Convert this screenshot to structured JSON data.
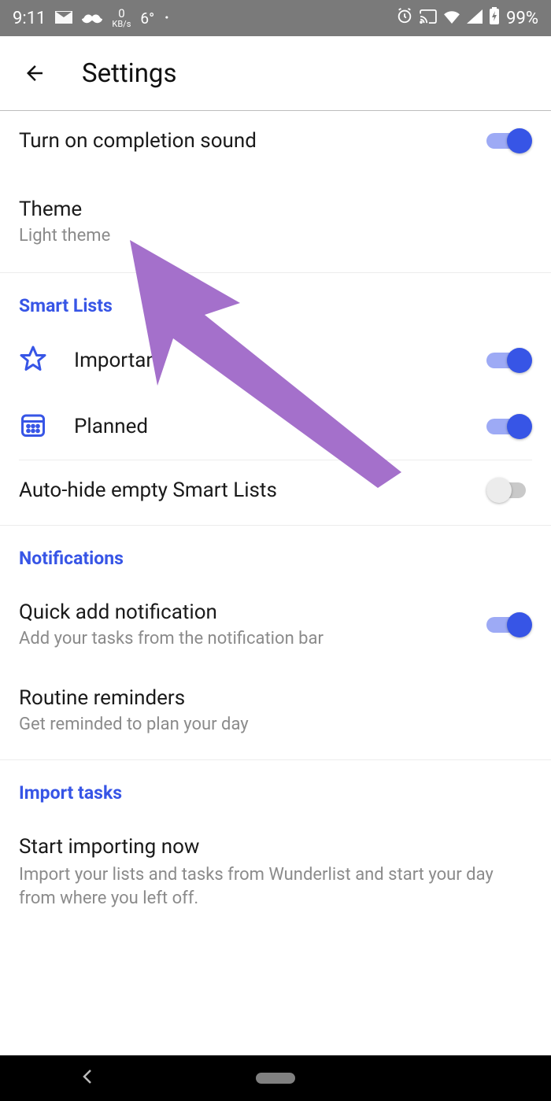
{
  "status": {
    "time": "9:11",
    "kbs_value": "0",
    "kbs_label": "KB/s",
    "temp": "6°",
    "battery": "99%"
  },
  "header": {
    "title": "Settings"
  },
  "general": {
    "completion_sound": {
      "label": "Turn on completion sound",
      "on": true
    },
    "theme": {
      "label": "Theme",
      "value": "Light theme"
    }
  },
  "smart_lists": {
    "header": "Smart Lists",
    "items": [
      {
        "id": "important",
        "label": "Important",
        "on": true
      },
      {
        "id": "planned",
        "label": "Planned",
        "on": true
      }
    ],
    "autohide": {
      "label": "Auto-hide empty Smart Lists",
      "on": false
    }
  },
  "notifications": {
    "header": "Notifications",
    "quick_add": {
      "label": "Quick add notification",
      "sub": "Add your tasks from the notification bar",
      "on": true
    },
    "routine": {
      "label": "Routine reminders",
      "sub": "Get reminded to plan your day"
    }
  },
  "import": {
    "header": "Import tasks",
    "start": {
      "label": "Start importing now",
      "sub": "Import your lists and tasks from Wunderlist and start your day from where you left off."
    }
  },
  "colors": {
    "accent": "#3755e6",
    "arrow": "#a470cb"
  }
}
